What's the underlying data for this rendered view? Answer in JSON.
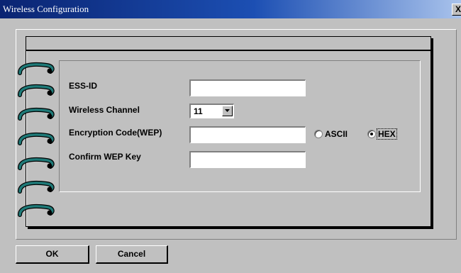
{
  "window": {
    "title": "Wireless Configuration",
    "close_label": "X"
  },
  "form": {
    "ess_id_label": "ESS-ID",
    "ess_id_value": "",
    "channel_label": "Wireless Channel",
    "channel_value": "11",
    "encryption_label": "Encryption Code(WEP)",
    "encryption_value": "",
    "ascii_label": "ASCII",
    "hex_label": "HEX",
    "selected_format": "HEX",
    "confirm_label": "Confirm WEP Key",
    "confirm_value": ""
  },
  "buttons": {
    "ok_label": "OK",
    "cancel_label": "Cancel"
  },
  "colors": {
    "ring": "#1f7a78",
    "titlebar": "#0a2472",
    "face": "#c0c0c0"
  },
  "icons": {
    "rings": "spiral-ring-icon",
    "close": "close-icon",
    "dropdown": "chevron-down-icon"
  }
}
